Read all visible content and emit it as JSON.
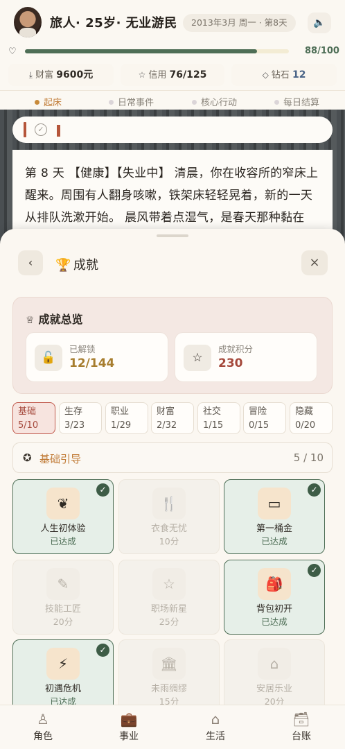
{
  "header": {
    "title": "旅人· 25岁· 无业游民",
    "date": "2013年3月 周一 · 第8天",
    "sound_icon": "speaker-icon",
    "health": {
      "text": "88/100",
      "value": 88,
      "max": 100
    },
    "stats": [
      {
        "icon": "download-icon",
        "label": "财富",
        "value": "9600元"
      },
      {
        "icon": "star-outline-icon",
        "label": "信用",
        "value": "76/125"
      },
      {
        "icon": "diamond-icon",
        "label": "钻石",
        "value": "12"
      }
    ],
    "tabs": [
      "起床",
      "日常事件",
      "核心行动",
      "每日结算"
    ],
    "active_tab": 0
  },
  "story": {
    "text": "第 8 天 【健康】【失业中】 清晨，你在收容所的窄床上醒来。周围有人翻身咳嗽，铁架床轻轻晃着，新的一天从排队洗漱开始。 晨风带着点湿气，是春天那种黏在"
  },
  "sheet": {
    "back_label": "‹",
    "title": "成就",
    "close_label": "×",
    "overview": {
      "title": "成就总览",
      "unlocked": {
        "label": "已解锁",
        "value": "12/144",
        "color": "#a77d2e"
      },
      "points": {
        "label": "成就积分",
        "value": "230",
        "color": "#a5493c"
      }
    },
    "categories": [
      {
        "name": "基础",
        "count": "5/10"
      },
      {
        "name": "生存",
        "count": "3/23"
      },
      {
        "name": "职业",
        "count": "1/29"
      },
      {
        "name": "财富",
        "count": "2/32"
      },
      {
        "name": "社交",
        "count": "1/15"
      },
      {
        "name": "冒险",
        "count": "0/15"
      },
      {
        "name": "隐藏",
        "count": "0/20"
      }
    ],
    "group": {
      "label": "基础引导",
      "count": "5 / 10"
    },
    "achievements": [
      {
        "name": "人生初体验",
        "sub": "已达成",
        "done": true,
        "icon": "leaf-icon"
      },
      {
        "name": "衣食无忧",
        "sub": "10分",
        "done": false,
        "icon": "fork-knife-icon"
      },
      {
        "name": "第一桶金",
        "sub": "已达成",
        "done": true,
        "icon": "banknote-icon"
      },
      {
        "name": "技能工匠",
        "sub": "20分",
        "done": false,
        "icon": "brush-icon"
      },
      {
        "name": "职场新星",
        "sub": "25分",
        "done": false,
        "icon": "star-icon"
      },
      {
        "name": "背包初开",
        "sub": "已达成",
        "done": true,
        "icon": "backpack-icon"
      },
      {
        "name": "初遇危机",
        "sub": "已达成",
        "done": true,
        "icon": "lightning-icon"
      },
      {
        "name": "未雨绸缪",
        "sub": "15分",
        "done": false,
        "icon": "bank-icon"
      },
      {
        "name": "安居乐业",
        "sub": "20分",
        "done": false,
        "icon": "house-icon"
      }
    ]
  },
  "nav": [
    {
      "label": "角色",
      "icon": "person-icon"
    },
    {
      "label": "事业",
      "icon": "briefcase-icon"
    },
    {
      "label": "生活",
      "icon": "home-icon"
    },
    {
      "label": "台账",
      "icon": "archive-box-icon"
    }
  ]
}
